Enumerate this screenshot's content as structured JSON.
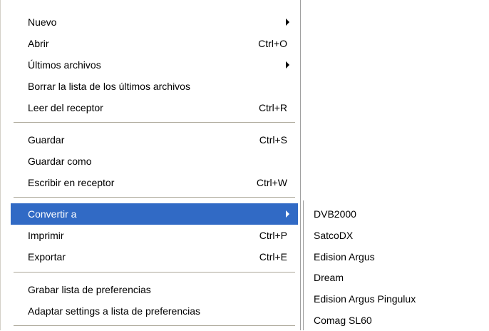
{
  "menu": {
    "items": [
      {
        "label": "Nuevo",
        "shortcut": "",
        "submenu": true
      },
      {
        "label": "Abrir",
        "shortcut": "Ctrl+O",
        "submenu": false
      },
      {
        "label": "Últimos archivos",
        "shortcut": "",
        "submenu": true
      },
      {
        "label": "Borrar la lista de los últimos archivos",
        "shortcut": "",
        "submenu": false
      },
      {
        "label": "Leer del receptor",
        "shortcut": "Ctrl+R",
        "submenu": false
      },
      {
        "label": "Guardar",
        "shortcut": "Ctrl+S",
        "submenu": false
      },
      {
        "label": "Guardar como",
        "shortcut": "",
        "submenu": false
      },
      {
        "label": "Escribir en receptor",
        "shortcut": "Ctrl+W",
        "submenu": false
      },
      {
        "label": "Convertir a",
        "shortcut": "",
        "submenu": true,
        "selected": true
      },
      {
        "label": "Imprimir",
        "shortcut": "Ctrl+P",
        "submenu": false
      },
      {
        "label": "Exportar",
        "shortcut": "Ctrl+E",
        "submenu": false
      },
      {
        "label": "Grabar lista de preferencias",
        "shortcut": "",
        "submenu": false
      },
      {
        "label": "Adaptar settings a lista de preferencias",
        "shortcut": "",
        "submenu": false
      }
    ]
  },
  "submenu": {
    "items": [
      {
        "label": "DVB2000"
      },
      {
        "label": "SatcoDX"
      },
      {
        "label": "Edision Argus"
      },
      {
        "label": "Dream"
      },
      {
        "label": "Edision Argus Pingulux"
      },
      {
        "label": "Comag SL60"
      }
    ]
  },
  "colors": {
    "highlight": "#316ac5",
    "highlight_text": "#ffffff",
    "separator": "#aca899"
  }
}
